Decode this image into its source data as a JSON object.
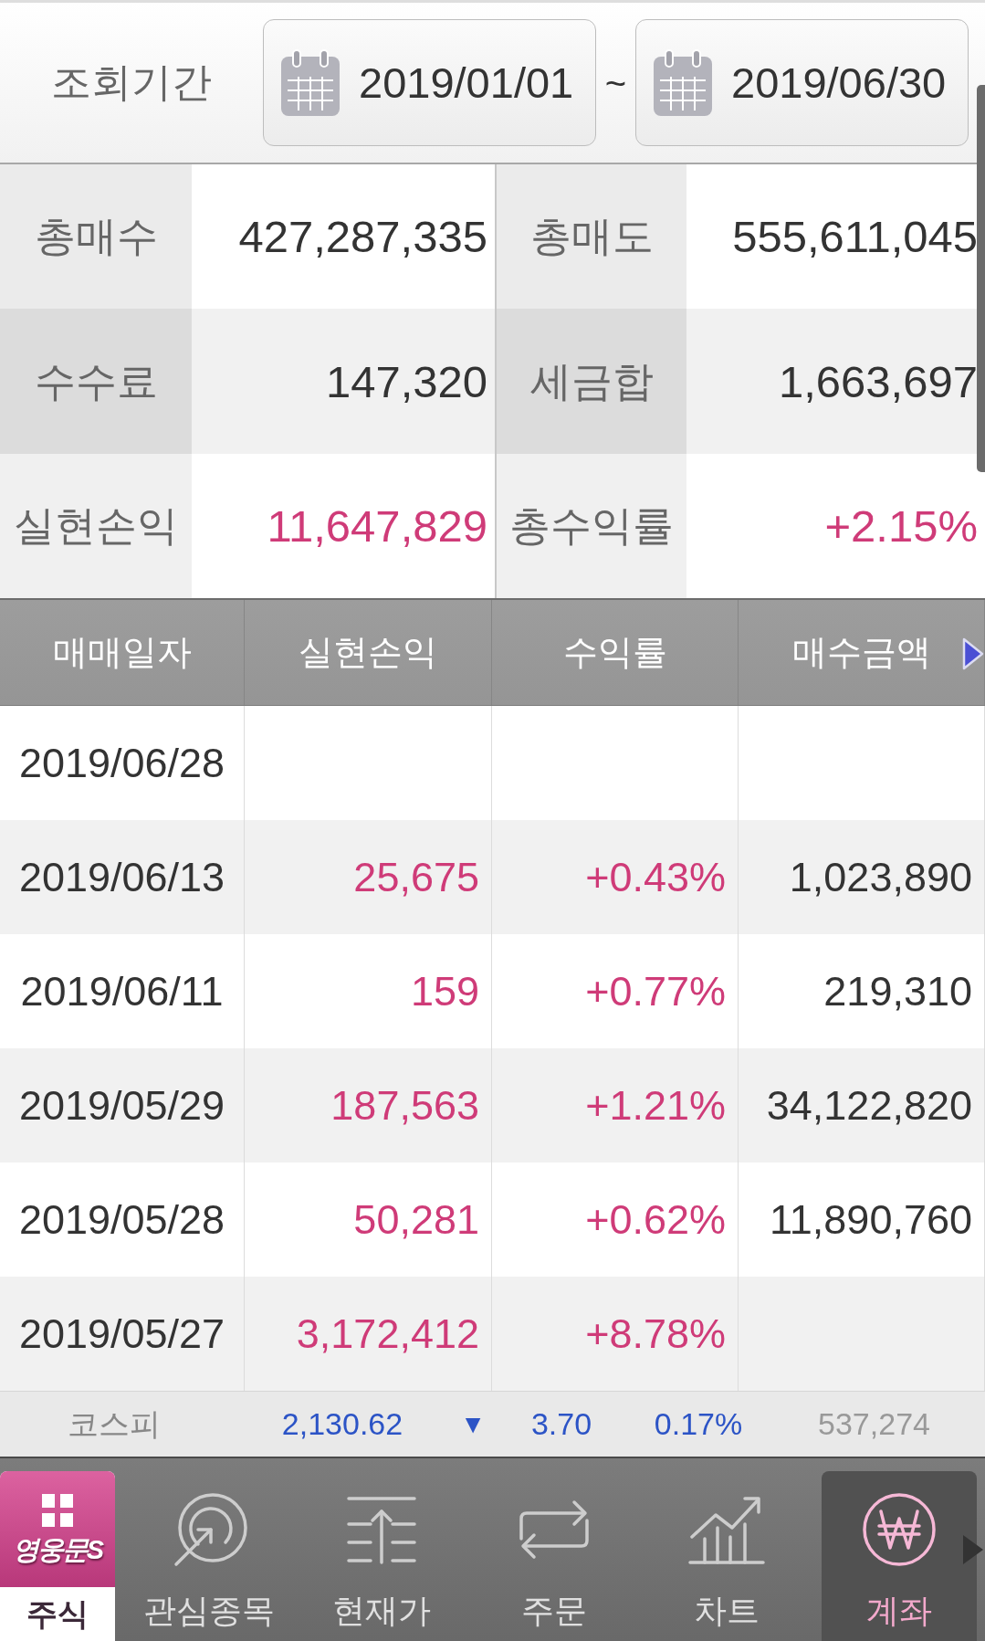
{
  "period": {
    "label": "조회기간",
    "start_date": "2019/01/01",
    "separator": "~",
    "end_date": "2019/06/30"
  },
  "summary": [
    {
      "label": "총매수",
      "value": "427,287,335",
      "color": "#333333"
    },
    {
      "label": "총매도",
      "value": "555,611,045",
      "color": "#333333"
    },
    {
      "label": "수수료",
      "value": "147,320",
      "color": "#333333"
    },
    {
      "label": "세금합",
      "value": "1,663,697",
      "color": "#333333"
    },
    {
      "label": "실현손익",
      "value": "11,647,829",
      "color": "#cf3b78"
    },
    {
      "label": "총수익률",
      "value": "+2.15%",
      "color": "#cf3b78"
    }
  ],
  "table": {
    "columns": [
      {
        "label": "매매일자",
        "color": "#333333"
      },
      {
        "label": "실현손익",
        "color": "#cf3b78"
      },
      {
        "label": "수익률",
        "color": "#cf3b78"
      },
      {
        "label": "매수금액",
        "color": "#333333"
      }
    ],
    "rows": [
      {
        "date": "2019/06/28"
      },
      {
        "date": "2019/06/13",
        "realized_pl": "25,675",
        "return_rate": "+0.43%",
        "buy_amount": "1,023,890"
      },
      {
        "date": "2019/06/11",
        "realized_pl": "159",
        "return_rate": "+0.77%",
        "buy_amount": "219,310"
      },
      {
        "date": "2019/05/29",
        "realized_pl": "187,563",
        "return_rate": "+1.21%",
        "buy_amount": "34,122,820"
      },
      {
        "date": "2019/05/28",
        "realized_pl": "50,281",
        "return_rate": "+0.62%",
        "buy_amount": "11,890,760"
      },
      {
        "date": "2019/05/27",
        "realized_pl": "3,172,412",
        "return_rate": "+8.78%"
      }
    ]
  },
  "ticker": {
    "name": "코스피",
    "value": "2,130.62",
    "arrow": "▼",
    "change": "3.70",
    "rate": "0.17%",
    "volume": "537,274"
  },
  "nav": {
    "brand": {
      "logo": "영웅문S",
      "label": "주식"
    },
    "items": [
      {
        "label": "관심종목",
        "selected": false
      },
      {
        "label": "현재가",
        "selected": false
      },
      {
        "label": "주문",
        "selected": false
      },
      {
        "label": "차트",
        "selected": false
      },
      {
        "label": "계좌",
        "selected": true
      }
    ]
  }
}
